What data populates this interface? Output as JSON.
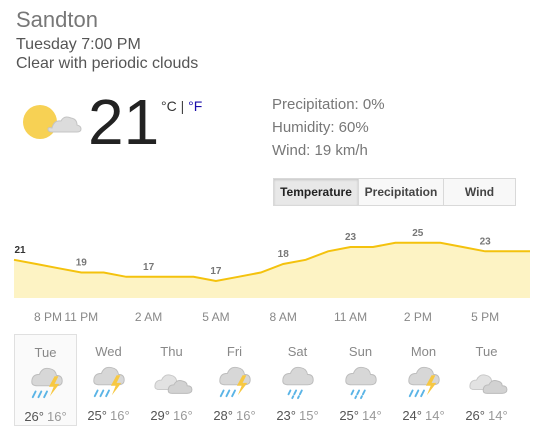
{
  "location": "Sandton",
  "datetime": "Tuesday 7:00 PM",
  "condition": "Clear with periodic clouds",
  "current": {
    "temperature": "21",
    "unit_c": "°C",
    "unit_sep": " | ",
    "unit_f": "°F",
    "icon": "partly-cloudy-icon"
  },
  "stats": {
    "precipitation": "Precipitation: 0%",
    "humidity": "Humidity: 60%",
    "wind": "Wind: 19 km/h"
  },
  "tabs": [
    {
      "label": "Temperature",
      "active": true
    },
    {
      "label": "Precipitation",
      "active": false
    },
    {
      "label": "Wind",
      "active": false
    }
  ],
  "chart_data": {
    "type": "area",
    "temps": [
      21,
      20,
      19,
      18,
      18,
      17,
      17,
      17,
      17,
      16,
      17,
      18,
      20,
      21,
      23,
      24,
      24,
      25,
      25,
      25,
      24,
      23,
      23,
      23
    ],
    "labels": [
      {
        "index": 0,
        "text": "21"
      },
      {
        "index": 3,
        "text": "19"
      },
      {
        "index": 6,
        "text": "17"
      },
      {
        "index": 9,
        "text": "17"
      },
      {
        "index": 12,
        "text": "18"
      },
      {
        "index": 15,
        "text": "23"
      },
      {
        "index": 18,
        "text": "25"
      },
      {
        "index": 21,
        "text": "23"
      }
    ],
    "x_labels": [
      "8 PM",
      "11 PM",
      "2 AM",
      "5 AM",
      "8 AM",
      "11 AM",
      "2 PM",
      "5 PM"
    ],
    "ylim": [
      12,
      28
    ],
    "line_color": "#f4c20d",
    "fill_color": "#fdf3c4"
  },
  "days": [
    {
      "name": "Tue",
      "high": "26°",
      "low": "16°",
      "icon": "thunderstorm-icon",
      "active": true
    },
    {
      "name": "Wed",
      "high": "25°",
      "low": "16°",
      "icon": "thunderstorm-icon",
      "active": false
    },
    {
      "name": "Thu",
      "high": "29°",
      "low": "16°",
      "icon": "cloudy-icon",
      "active": false
    },
    {
      "name": "Fri",
      "high": "28°",
      "low": "16°",
      "icon": "thunderstorm-icon",
      "active": false
    },
    {
      "name": "Sat",
      "high": "23°",
      "low": "15°",
      "icon": "rain-icon",
      "active": false
    },
    {
      "name": "Sun",
      "high": "25°",
      "low": "14°",
      "icon": "rain-icon",
      "active": false
    },
    {
      "name": "Mon",
      "high": "24°",
      "low": "14°",
      "icon": "thunderstorm-icon",
      "active": false
    },
    {
      "name": "Tue",
      "high": "26°",
      "low": "14°",
      "icon": "cloudy-icon",
      "active": false
    }
  ]
}
